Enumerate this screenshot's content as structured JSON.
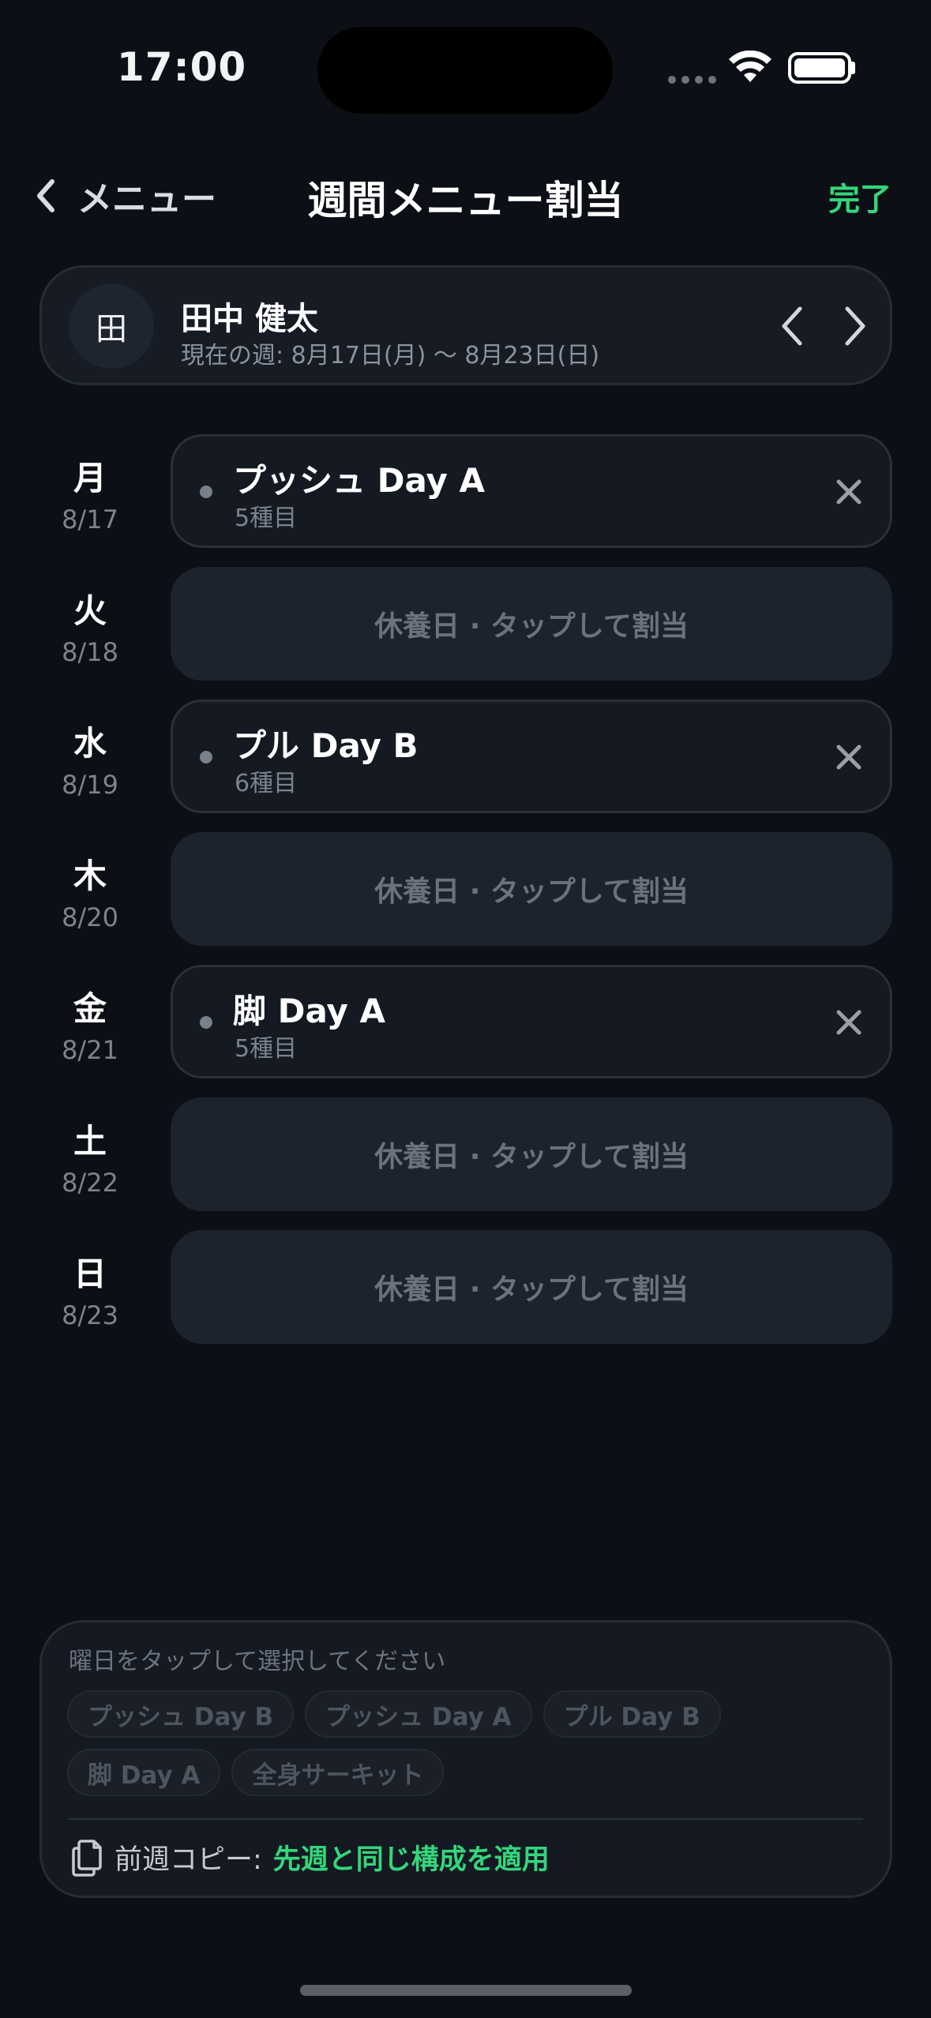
{
  "status_bar": {
    "time": "17:00"
  },
  "nav": {
    "back_label": "メニュー",
    "title": "週間メニュー割当",
    "done_label": "完了"
  },
  "client": {
    "avatar_initial": "田",
    "name": "田中 健太",
    "week_range": "現在の週: 8月17日(月) 〜 8月23日(日)"
  },
  "days": [
    {
      "dow": "月",
      "date": "8/17",
      "menu": "プッシュ Day A",
      "count": "5種目"
    },
    {
      "dow": "火",
      "date": "8/18",
      "rest_text": "休養日 · タップして割当"
    },
    {
      "dow": "水",
      "date": "8/19",
      "menu": "プル Day B",
      "count": "6種目"
    },
    {
      "dow": "木",
      "date": "8/20",
      "rest_text": "休養日 · タップして割当"
    },
    {
      "dow": "金",
      "date": "8/21",
      "menu": "脚 Day A",
      "count": "5種目"
    },
    {
      "dow": "土",
      "date": "8/22",
      "rest_text": "休養日 · タップして割当"
    },
    {
      "dow": "日",
      "date": "8/23",
      "rest_text": "休養日 · タップして割当"
    }
  ],
  "panel": {
    "hint": "曜日をタップして選択してください",
    "chips": [
      "プッシュ Day B",
      "プッシュ Day A",
      "プル Day B",
      "脚 Day A",
      "全身サーキット"
    ],
    "copy_prefix": "前週コピー:",
    "copy_action": "先週と同じ構成を適用"
  },
  "colors": {
    "accent": "#34d67c",
    "background": "#0c0f15"
  },
  "icons": {
    "back": "chevron-left-icon",
    "prev_week": "chevron-left-icon",
    "next_week": "chevron-right-icon",
    "remove": "close-icon",
    "copy": "copy-icon",
    "wifi": "wifi-icon",
    "battery": "battery-icon"
  }
}
